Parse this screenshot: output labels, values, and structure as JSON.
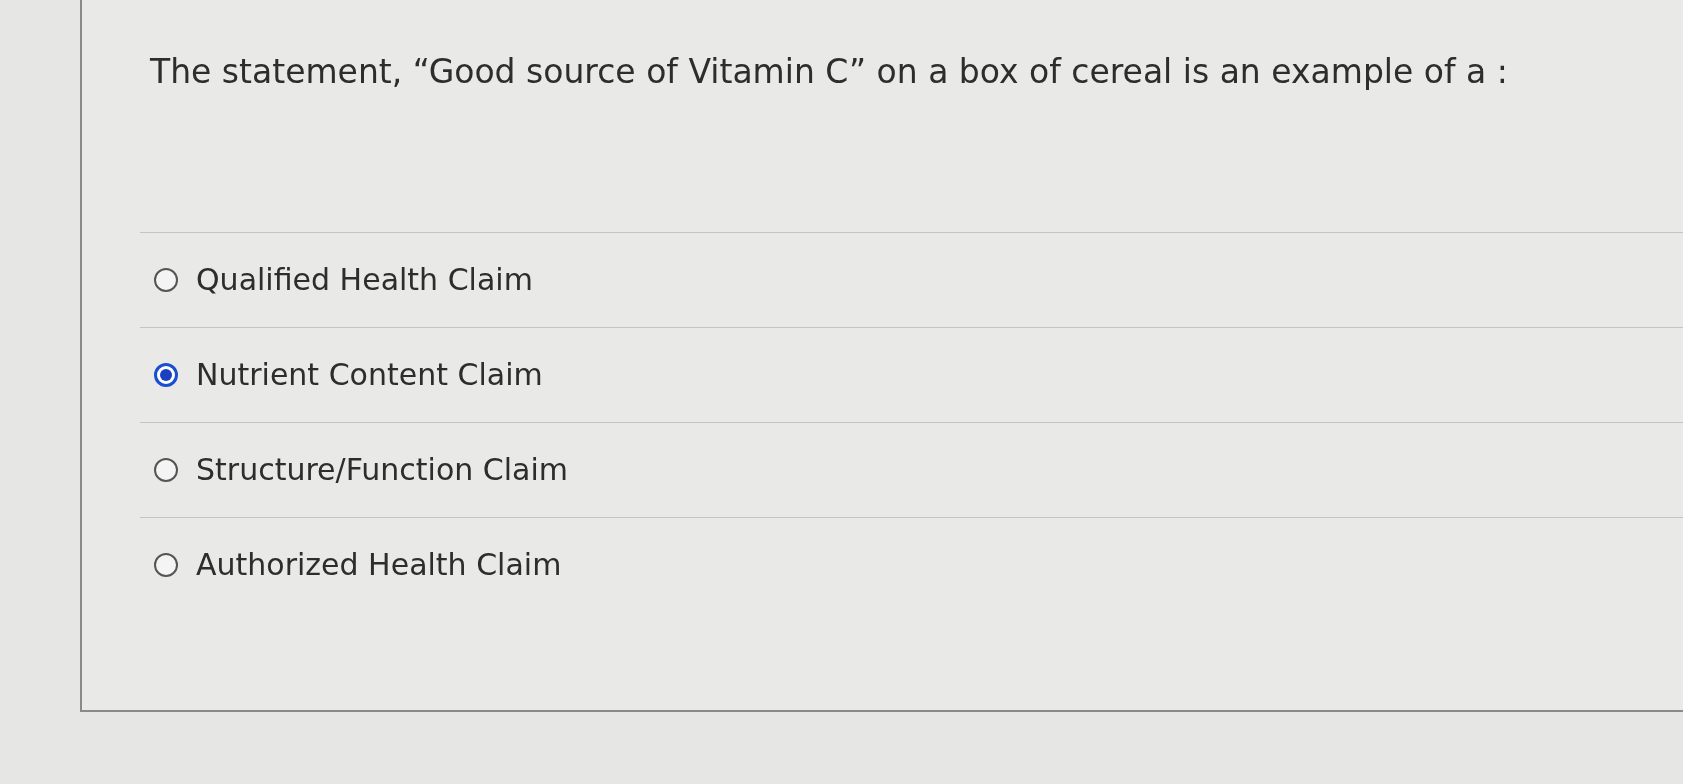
{
  "question": {
    "text": "The statement, “Good source of Vitamin C” on a box of cereal is an example of a :"
  },
  "options": [
    {
      "label": "Qualified Health Claim",
      "selected": false
    },
    {
      "label": "Nutrient Content Claim",
      "selected": true
    },
    {
      "label": "Structure/Function Claim",
      "selected": false
    },
    {
      "label": "Authorized Health Claim",
      "selected": false
    }
  ]
}
